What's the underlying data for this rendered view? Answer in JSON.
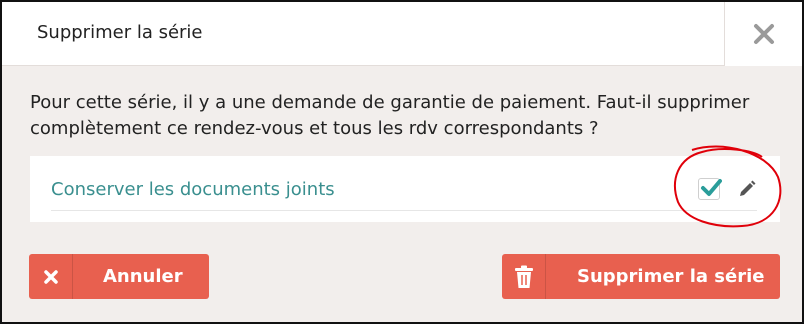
{
  "dialog": {
    "title": "Supprimer la série",
    "close_icon": "close-icon",
    "message": "Pour cette série, il y a une demande de garantie de paiement. Faut-il supprimer complètement ce rendez-vous et tous les rdv correspondants ?"
  },
  "option": {
    "label": "Conserver les documents joints",
    "checked": true,
    "checkbox_icon": "checkmark-icon",
    "edit_icon": "pencil-icon"
  },
  "buttons": {
    "cancel_label": "Annuler",
    "cancel_icon": "x-icon",
    "delete_label": "Supprimer la série",
    "delete_icon": "trash-icon"
  },
  "colors": {
    "accent": "#e8604f",
    "teal": "#3a8f8f",
    "annotation": "#e0000a"
  }
}
